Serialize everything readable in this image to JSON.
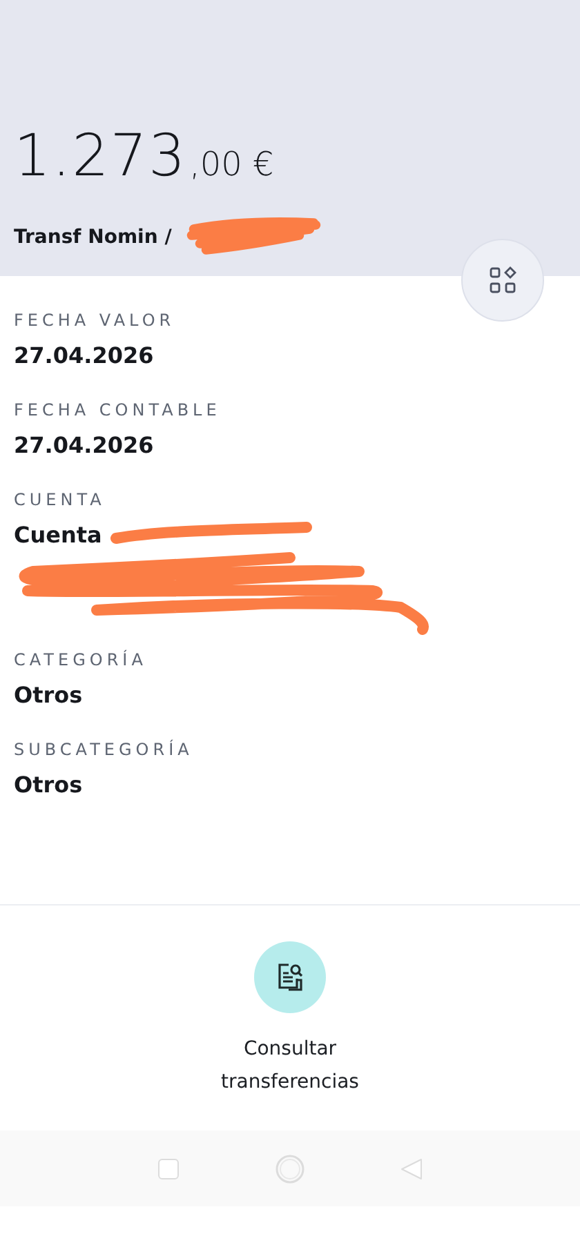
{
  "header": {
    "amount_whole": "1.273",
    "amount_fraction": ",00 €",
    "description": "Transf Nomin /"
  },
  "fields": [
    {
      "label": "FECHA VALOR",
      "value": "27.04.2026"
    },
    {
      "label": "FECHA CONTABLE",
      "value": "27.04.2026"
    },
    {
      "label": "CUENTA",
      "value": "Cuenta",
      "redacted": true
    },
    {
      "label": "CATEGORÍA",
      "value": "Otros"
    },
    {
      "label": "SUBCATEGORÍA",
      "value": "Otros"
    }
  ],
  "action": {
    "label": "Consultar transferencias"
  }
}
